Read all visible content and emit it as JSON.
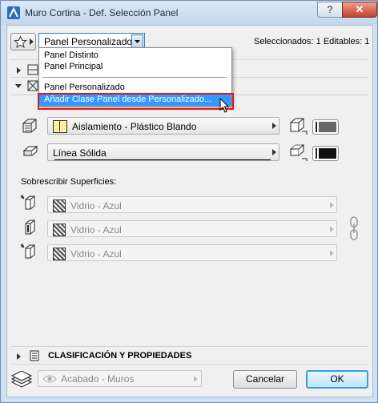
{
  "window": {
    "title": "Muro Cortina - Def. Selección Panel",
    "help_label": "?",
    "close_label": "✕"
  },
  "header": {
    "panel_combo_value": "Panel Personalizado",
    "selection_status": "Seleccionados: 1 Editables: 1"
  },
  "dropdown": {
    "items": [
      "Panel Distinto",
      "Panel Principal",
      "Panel Personalizado",
      "Añadir Clase Panel desde Personalizado..."
    ]
  },
  "material": {
    "building_material": "Aislamiento - Plástico Blando",
    "line_type": "Línea Sólida"
  },
  "surfaces": {
    "label": "Sobrescribir Superficies:",
    "items": [
      "Vidrio - Azul",
      "Vidrio - Azul",
      "Vidrio - Azul"
    ]
  },
  "classification": {
    "label": "CLASIFICACIÓN Y PROPIEDADES"
  },
  "footer": {
    "layer_value": "Acabado - Muros",
    "cancel_label": "Cancelar",
    "ok_label": "OK"
  },
  "colors": {
    "highlight": "#3399ff",
    "highlight_border": "#e0191b",
    "titlebar": "#c3d7ee"
  }
}
